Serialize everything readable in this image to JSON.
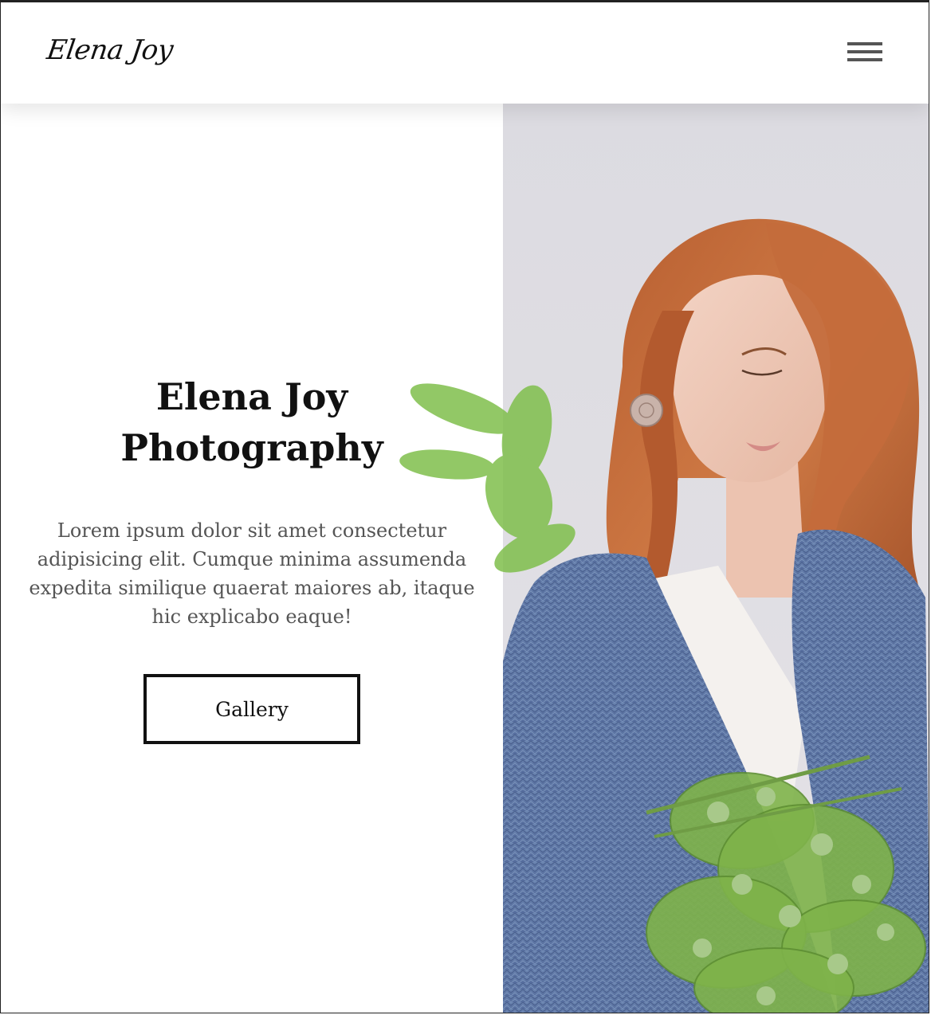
{
  "header": {
    "logo": "Elena Joy",
    "menu_icon": "hamburger-menu-icon"
  },
  "hero": {
    "title_line1": "Elena Joy",
    "title_line2": "Photography",
    "text": "Lorem ipsum dolor sit amet consectetur adipisicing elit. Cumque minima assumenda expedita similique quaerat maiores ab, itaque hic explicabo eaque!",
    "button_label": "Gallery"
  },
  "colors": {
    "background": "#ffffff",
    "text": "#111111",
    "body_text": "#555555",
    "photo_backdrop": "#dddde2",
    "hair": "#c06a3a",
    "sweater": "#5f7aa6",
    "foliage": "#7fb34a"
  }
}
